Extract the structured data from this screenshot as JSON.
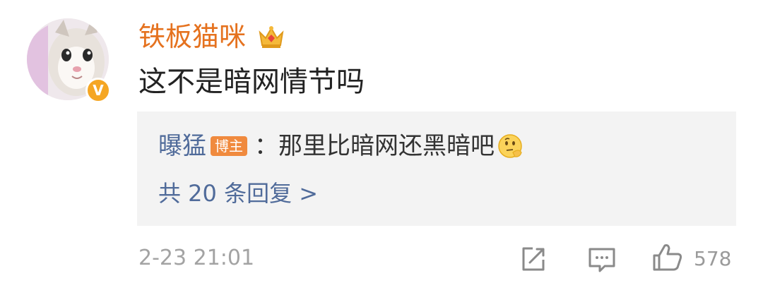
{
  "comment": {
    "username": "铁板猫咪",
    "text": "这不是暗网情节吗",
    "verified_badge": "V",
    "crown_icon": "crown-icon",
    "colors": {
      "username": "#e5721f",
      "badge": "#f5a623"
    }
  },
  "reply": {
    "username": "曝猛",
    "tag": "博主",
    "separator": "：",
    "text": "那里比暗网还黑暗吧",
    "emoji": "thinking-face-emoji",
    "more_replies": "共 20 条回复 >",
    "colors": {
      "link": "#506b9a",
      "tag_bg": "#f08a3e",
      "box_bg": "#f3f3f3"
    }
  },
  "footer": {
    "timestamp": "2-23 21:01",
    "share_icon": "share-icon",
    "comment_icon": "comment-icon",
    "like_icon": "like-icon",
    "like_count": "578"
  }
}
